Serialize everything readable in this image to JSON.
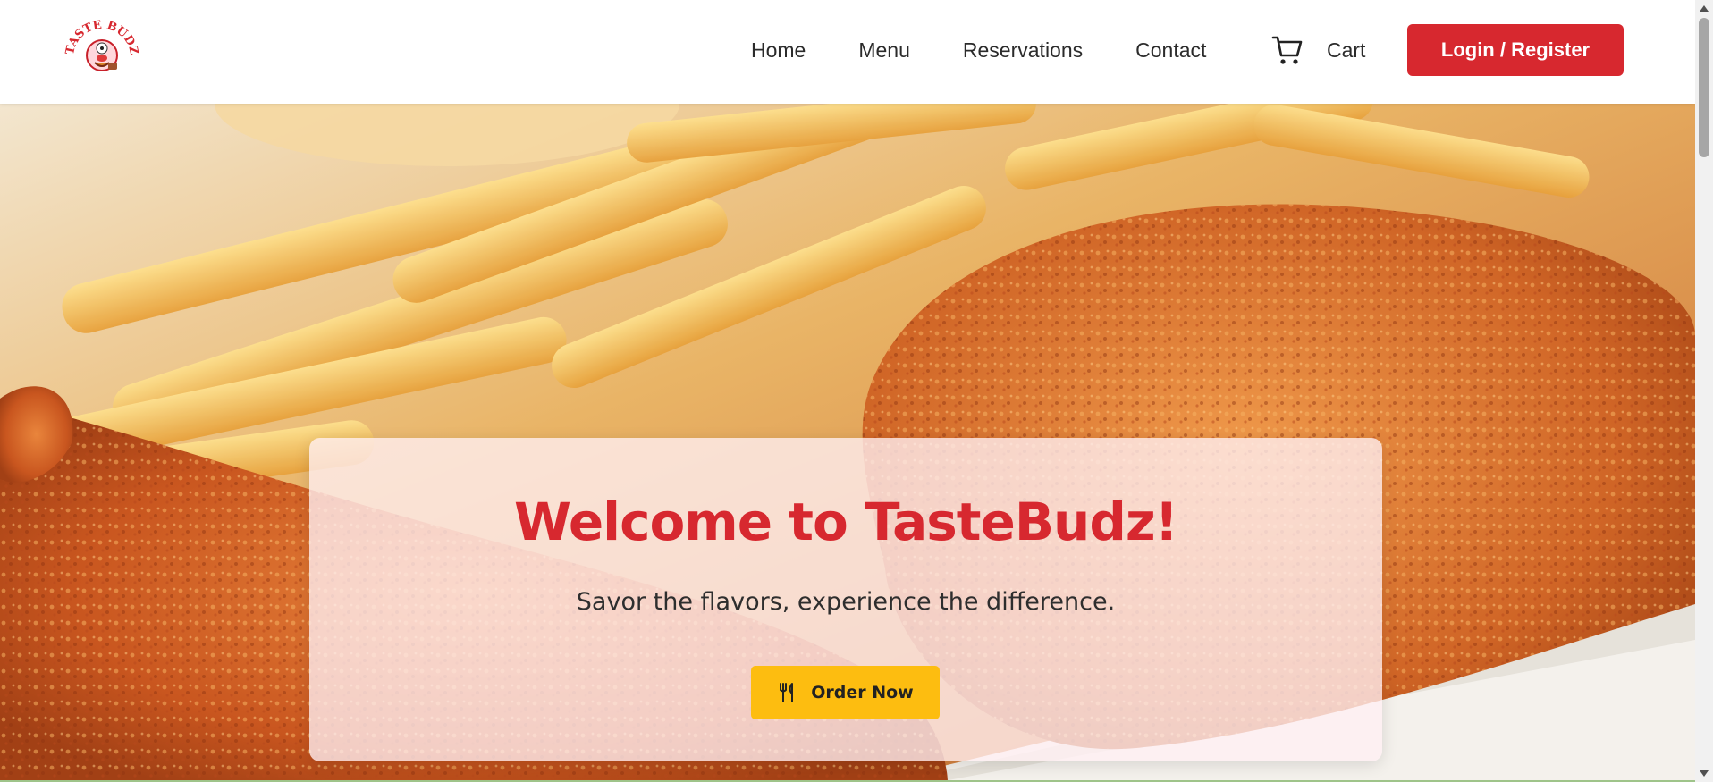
{
  "navbar": {
    "logo_text": "TASTE BUDZ",
    "links": [
      "Home",
      "Menu",
      "Reservations",
      "Contact"
    ],
    "cart_label": "Cart",
    "login_label": "Login / Register"
  },
  "hero": {
    "title": "Welcome to TasteBudz!",
    "subtitle": "Savor the flavors, experience the difference.",
    "order_button": "Order Now"
  },
  "colors": {
    "brand_red": "#d7282f",
    "accent_yellow": "#fdbd10"
  },
  "icons": {
    "cart": "shopping-cart-icon",
    "order": "fork-knife-icon"
  }
}
